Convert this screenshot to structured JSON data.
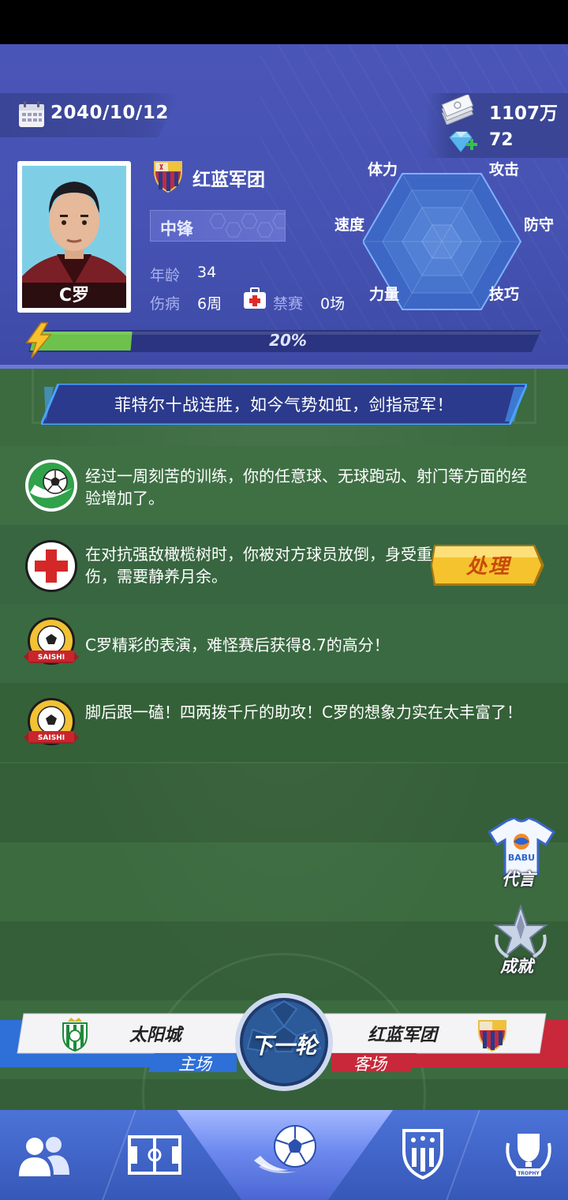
{
  "date": "2040/10/12",
  "currency": {
    "cash": "1107万",
    "gems": "72"
  },
  "player": {
    "name": "C罗",
    "club": "红蓝军团",
    "position": "中锋",
    "age_label": "年龄",
    "age": "34",
    "injury_label": "伤病",
    "injury": "6周",
    "suspension_label": "禁赛",
    "suspension": "0场",
    "energy_percent": 20,
    "energy_text": "20%"
  },
  "radar": {
    "labels": {
      "stamina": "体力",
      "attack": "攻击",
      "speed": "速度",
      "defense": "防守",
      "strength": "力量",
      "technique": "技巧"
    }
  },
  "headline": "菲特尔十战连胜，如今气势如虹，剑指冠军！",
  "feed": [
    {
      "icon": "training-ball-icon",
      "text": "经过一周刻苦的训练，你的任意球、无球跑动、射门等方面的经验增加了。"
    },
    {
      "icon": "medical-cross-icon",
      "text": "在对抗强敌橄榄树时，你被对方球员放倒，身受重伤，需要静养月余。",
      "action": "处理"
    },
    {
      "icon": "saishi-badge-icon",
      "badge": "SAISHI",
      "text": "C罗精彩的表演，难怪赛后获得8.7的高分！"
    },
    {
      "icon": "saishi-badge-icon",
      "badge": "SAISHI",
      "text": "脚后跟一磕！四两拨千斤的助攻！C罗的想象力实在太丰富了！"
    }
  ],
  "side_buttons": {
    "endorse": "代言",
    "endorse_jersey": "BABU",
    "achievements": "成就"
  },
  "match": {
    "home_team": "太阳城",
    "home_label": "主场",
    "away_team": "红蓝军团",
    "away_label": "客场",
    "next_round": "下一轮"
  },
  "nav": [
    {
      "icon": "team-icon"
    },
    {
      "icon": "tactics-field-icon"
    },
    {
      "icon": "match-ball-icon",
      "active": true
    },
    {
      "icon": "club-crest-icon"
    },
    {
      "icon": "trophy-icon",
      "label": "TROPHY"
    }
  ],
  "colors": {
    "panel": "#4653b3",
    "energy_fill": "#6cc24a",
    "handle_button": "#f5c32e",
    "home_blue": "#2e6fd8",
    "away_red": "#c8283a"
  }
}
